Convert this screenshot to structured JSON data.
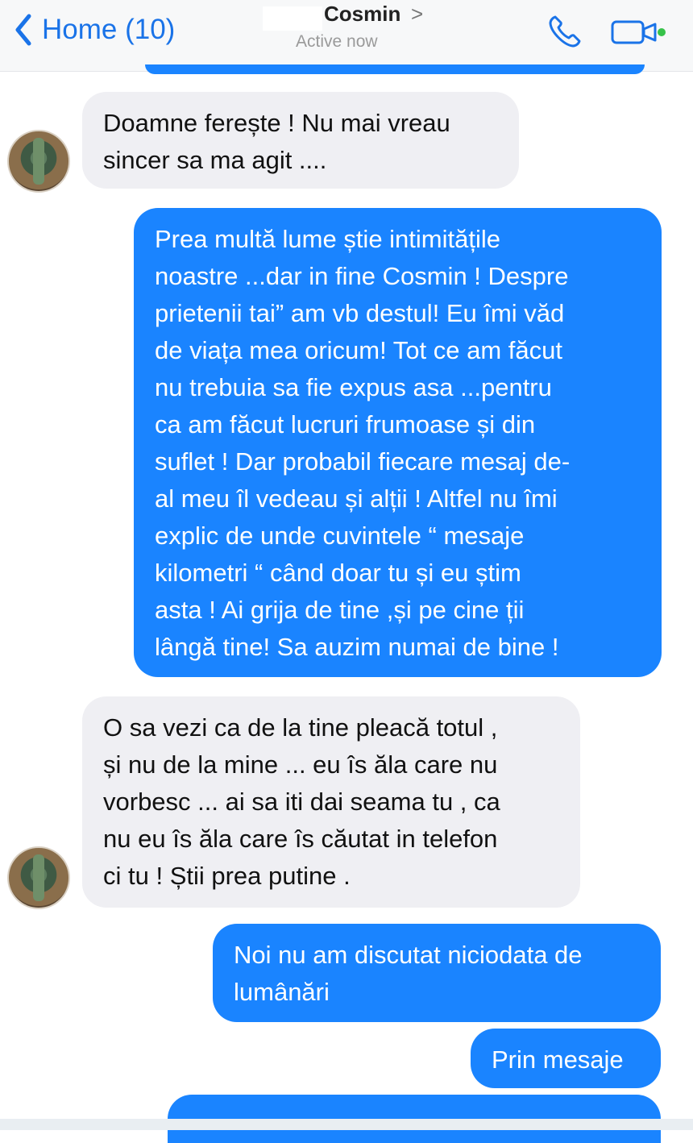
{
  "header": {
    "back_label": "Home (10)",
    "contact_name": "Cosmin",
    "chevron": ">",
    "status": "Active now"
  },
  "messages": [
    {
      "side": "in",
      "text": "Doamne ferește ! Nu mai vreau\nsincer sa ma agit ...."
    },
    {
      "side": "out",
      "text": "Prea multă lume știe intimitățile\nnoastre ...dar in fine Cosmin ! Despre\nprietenii tai” am vb destul! Eu îmi văd\nde viața mea oricum! Tot ce am făcut\nnu trebuia sa fie expus asa ...pentru\nca am făcut lucruri frumoase și din\nsuflet ! Dar probabil fiecare mesaj de-\nal meu îl vedeau și alții ! Altfel nu îmi\nexplic de unde cuvintele “ mesaje\nkilometri “ când doar tu și eu știm\nasta ! Ai grija de tine ,și pe cine ții\nlângă tine! Sa auzim numai de bine !"
    },
    {
      "side": "in",
      "text": "O sa vezi ca de la tine pleacă totul ,\nși nu de la mine ... eu îs ăla care nu\nvorbesc ... ai sa iti dai seama tu , ca\nnu eu îs ăla care îs căutat in telefon\nci tu ! Știi prea putine ."
    },
    {
      "side": "out",
      "text": "Noi nu am discutat niciodata de\nlumânări"
    },
    {
      "side": "out",
      "text": "Prin mesaje"
    }
  ],
  "colors": {
    "accent": "#1a84ff",
    "incoming_bubble": "#efeff3",
    "header_link": "#1a73e8"
  },
  "icons": [
    "chevron-left-icon",
    "phone-icon",
    "video-camera-icon"
  ]
}
